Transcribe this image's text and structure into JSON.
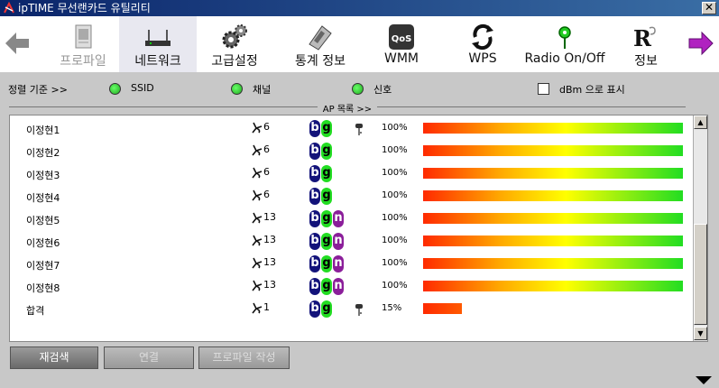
{
  "window": {
    "title": "ipTIME 무선랜카드 유틸리티",
    "close_label": "✕"
  },
  "toolbar": {
    "items": [
      {
        "label": "프로파일",
        "icon": "profile-icon",
        "state": "disabled"
      },
      {
        "label": "네트워크",
        "icon": "router-icon",
        "state": "active"
      },
      {
        "label": "고급설정",
        "icon": "gears-icon",
        "state": "normal"
      },
      {
        "label": "통계 정보",
        "icon": "calculator-icon",
        "state": "normal"
      },
      {
        "label": "WMM",
        "icon": "qos-icon",
        "state": "normal"
      },
      {
        "label": "WPS",
        "icon": "wps-icon",
        "state": "normal"
      },
      {
        "label": "Radio On/Off",
        "icon": "antenna-icon",
        "state": "normal"
      },
      {
        "label": "정보",
        "icon": "info-r-icon",
        "state": "normal"
      }
    ],
    "qos_text": "QoS",
    "r_text": "R"
  },
  "sort": {
    "label": "정렬 기준 >>",
    "options": [
      "SSID",
      "채널",
      "신호"
    ],
    "dbm_label": "dBm 으로 표시"
  },
  "ap_list": {
    "header": "AP 목록 >>",
    "rows": [
      {
        "ssid": "이정현1",
        "channel": "6",
        "modes": [
          "b",
          "g"
        ],
        "locked": true,
        "signal_text": "100%",
        "signal": 1.0
      },
      {
        "ssid": "이정현2",
        "channel": "6",
        "modes": [
          "b",
          "g"
        ],
        "locked": false,
        "signal_text": "100%",
        "signal": 1.0
      },
      {
        "ssid": "이정현3",
        "channel": "6",
        "modes": [
          "b",
          "g"
        ],
        "locked": false,
        "signal_text": "100%",
        "signal": 1.0
      },
      {
        "ssid": "이정현4",
        "channel": "6",
        "modes": [
          "b",
          "g"
        ],
        "locked": false,
        "signal_text": "100%",
        "signal": 1.0
      },
      {
        "ssid": "이정현5",
        "channel": "13",
        "modes": [
          "b",
          "g",
          "n"
        ],
        "locked": false,
        "signal_text": "100%",
        "signal": 1.0
      },
      {
        "ssid": "이정현6",
        "channel": "13",
        "modes": [
          "b",
          "g",
          "n"
        ],
        "locked": false,
        "signal_text": "100%",
        "signal": 1.0
      },
      {
        "ssid": "이정현7",
        "channel": "13",
        "modes": [
          "b",
          "g",
          "n"
        ],
        "locked": false,
        "signal_text": "100%",
        "signal": 1.0
      },
      {
        "ssid": "이정현8",
        "channel": "13",
        "modes": [
          "b",
          "g",
          "n"
        ],
        "locked": false,
        "signal_text": "100%",
        "signal": 1.0
      },
      {
        "ssid": "합격",
        "channel": "1",
        "modes": [
          "b",
          "g"
        ],
        "locked": true,
        "signal_text": "15%",
        "signal": 0.15
      }
    ]
  },
  "buttons": {
    "rescan": "재검색",
    "connect": "연결",
    "add_profile": "프로파일 작성"
  },
  "colors": {
    "titlebar": "#0a246a",
    "badge_b": "#13137a",
    "badge_g": "#22dd22",
    "badge_n": "#8b1e9a"
  }
}
